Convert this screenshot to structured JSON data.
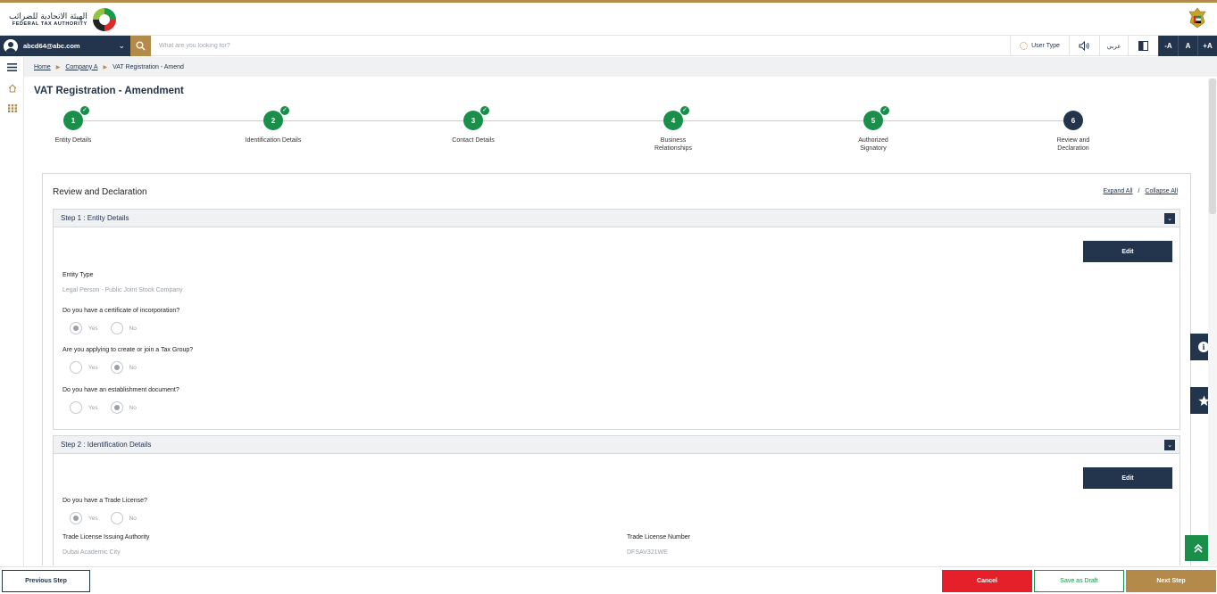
{
  "header": {
    "logo_ar": "الهيئة الاتحادية للضرائب",
    "logo_en": "FEDERAL TAX AUTHORITY"
  },
  "searchbar": {
    "account_email": "abcd64@abc.com",
    "search_placeholder": "What are you looking for?",
    "user_type": "User Type",
    "arabic": "عربي",
    "font_decrease": "-A",
    "font_normal": "A",
    "font_increase": "+A"
  },
  "breadcrumb": {
    "home": "Home",
    "company": "Company A",
    "current": "VAT Registration - Amend"
  },
  "page_title": "VAT Registration - Amendment",
  "stepper": {
    "steps": [
      {
        "num": "1",
        "label": "Entity Details",
        "status": "done"
      },
      {
        "num": "2",
        "label": "Identification Details",
        "status": "done"
      },
      {
        "num": "3",
        "label": "Contact Details",
        "status": "done"
      },
      {
        "num": "4",
        "label": "Business Relationships",
        "status": "done"
      },
      {
        "num": "5",
        "label": "Authorized Signatory",
        "status": "done"
      },
      {
        "num": "6",
        "label": "Review and Declaration",
        "status": "current"
      }
    ]
  },
  "review": {
    "title": "Review and Declaration",
    "expand_all": "Expand All",
    "separator": "/",
    "collapse_all": "Collapse All",
    "edit_label": "Edit",
    "step1": {
      "title": "Step 1 : Entity Details",
      "entity_type_label": "Entity Type",
      "entity_type_value": "Legal Person - Public Joint Stock Company",
      "q1": "Do you have a certificate of incorporation?",
      "q2": "Are you applying to create or join a Tax Group?",
      "q3": "Do you have an establishment document?",
      "yes": "Yes",
      "no": "No"
    },
    "step2": {
      "title": "Step 2 : Identification Details",
      "q1": "Do you have a Trade License?",
      "authority_label": "Trade License Issuing Authority",
      "authority_value": "Dubai Academic City",
      "number_label": "Trade License Number",
      "number_value": "DFSAV321WE",
      "yes": "Yes",
      "no": "No"
    }
  },
  "footer": {
    "previous": "Previous Step",
    "cancel": "Cancel",
    "draft": "Save as Draft",
    "next": "Next Step"
  }
}
